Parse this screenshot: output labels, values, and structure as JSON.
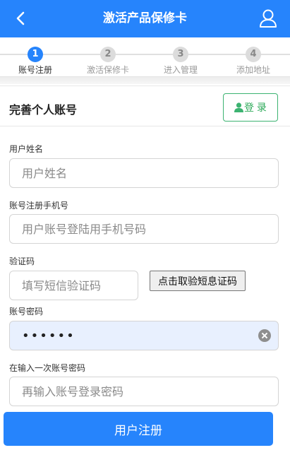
{
  "header": {
    "title": "激活产品保修卡",
    "back_icon": "chevron-left-icon",
    "user_icon": "user-icon",
    "color": "#2684fc"
  },
  "steps": [
    {
      "num": "1",
      "label": "账号注册",
      "active": true
    },
    {
      "num": "2",
      "label": "激活保修卡",
      "active": false
    },
    {
      "num": "3",
      "label": "进入管理",
      "active": false
    },
    {
      "num": "4",
      "label": "添加地址",
      "active": false
    }
  ],
  "section": {
    "title": "完善个人账号",
    "login_label": "登 录",
    "login_icon": "person-icon",
    "login_color": "#3cb371"
  },
  "form": {
    "name_label": "用户姓名",
    "name_placeholder": "用户姓名",
    "phone_label": "账号注册手机号",
    "phone_placeholder": "用户账号登陆用手机号码",
    "code_label": "验证码",
    "code_placeholder": "填写短信验证码",
    "sms_button": "点击取验短息证码",
    "password_label": "账号密码",
    "password_value": "••••••",
    "confirm_label": "在输入一次账号密码",
    "confirm_placeholder": "再输入账号登录密码"
  },
  "submit_label": "用户注册"
}
